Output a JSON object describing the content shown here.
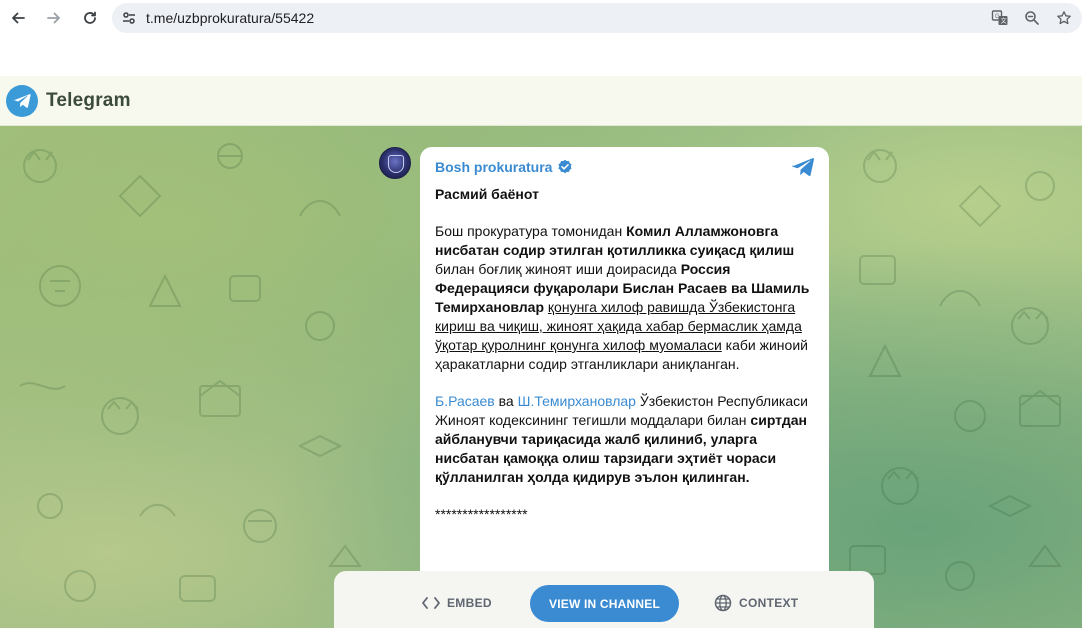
{
  "browser": {
    "url": "t.me/uzbprokuratura/55422"
  },
  "header": {
    "app_name": "Telegram"
  },
  "post": {
    "channel_name": "Bosh prokuratura",
    "title": "Расмий баёнот",
    "paragraph1": {
      "t1": "Бош прокуратура томонидан ",
      "b1": "Комил Алламжоновга нисбатан содир этилган қотилликка суиқасд қилиш",
      "t2": " билан боғлиқ жиноят иши доирасида ",
      "b2": "Россия Федерацияси фуқаролари Бислан Расаев ва Шамиль Темирхановлар",
      "t3": " ",
      "u1": "қонунга хилоф равишда Ўзбекистонга кириш ва чиқиш, жиноят ҳақида хабар бермаслик ҳамда ўқотар қуролнинг қонунга хилоф муомаласи",
      "t4": " каби жиноий ҳаракатларни содир этганликлари аниқланган."
    },
    "paragraph2": {
      "link1": "Б.Расаев",
      "t1": " ва ",
      "link2": "Ш.Темирхановлар",
      "t2": " Ўзбекистон Республикаси Жиноят кодексининг тегишли моддалари билан ",
      "b1": "сиртдан айбланувчи тариқасида жалб қилиниб, уларга нисбатан қамоққа олиш тарзидаги эҳтиёт чораси қўлланилган ҳолда қидирув эълон қилинган."
    },
    "separator": "*****************"
  },
  "actions": {
    "embed_label": "EMBED",
    "view_label": "VIEW IN CHANNEL",
    "context_label": "CONTEXT"
  },
  "colors": {
    "accent": "#3a8bd1",
    "header_bg": "#f7f9ee"
  }
}
